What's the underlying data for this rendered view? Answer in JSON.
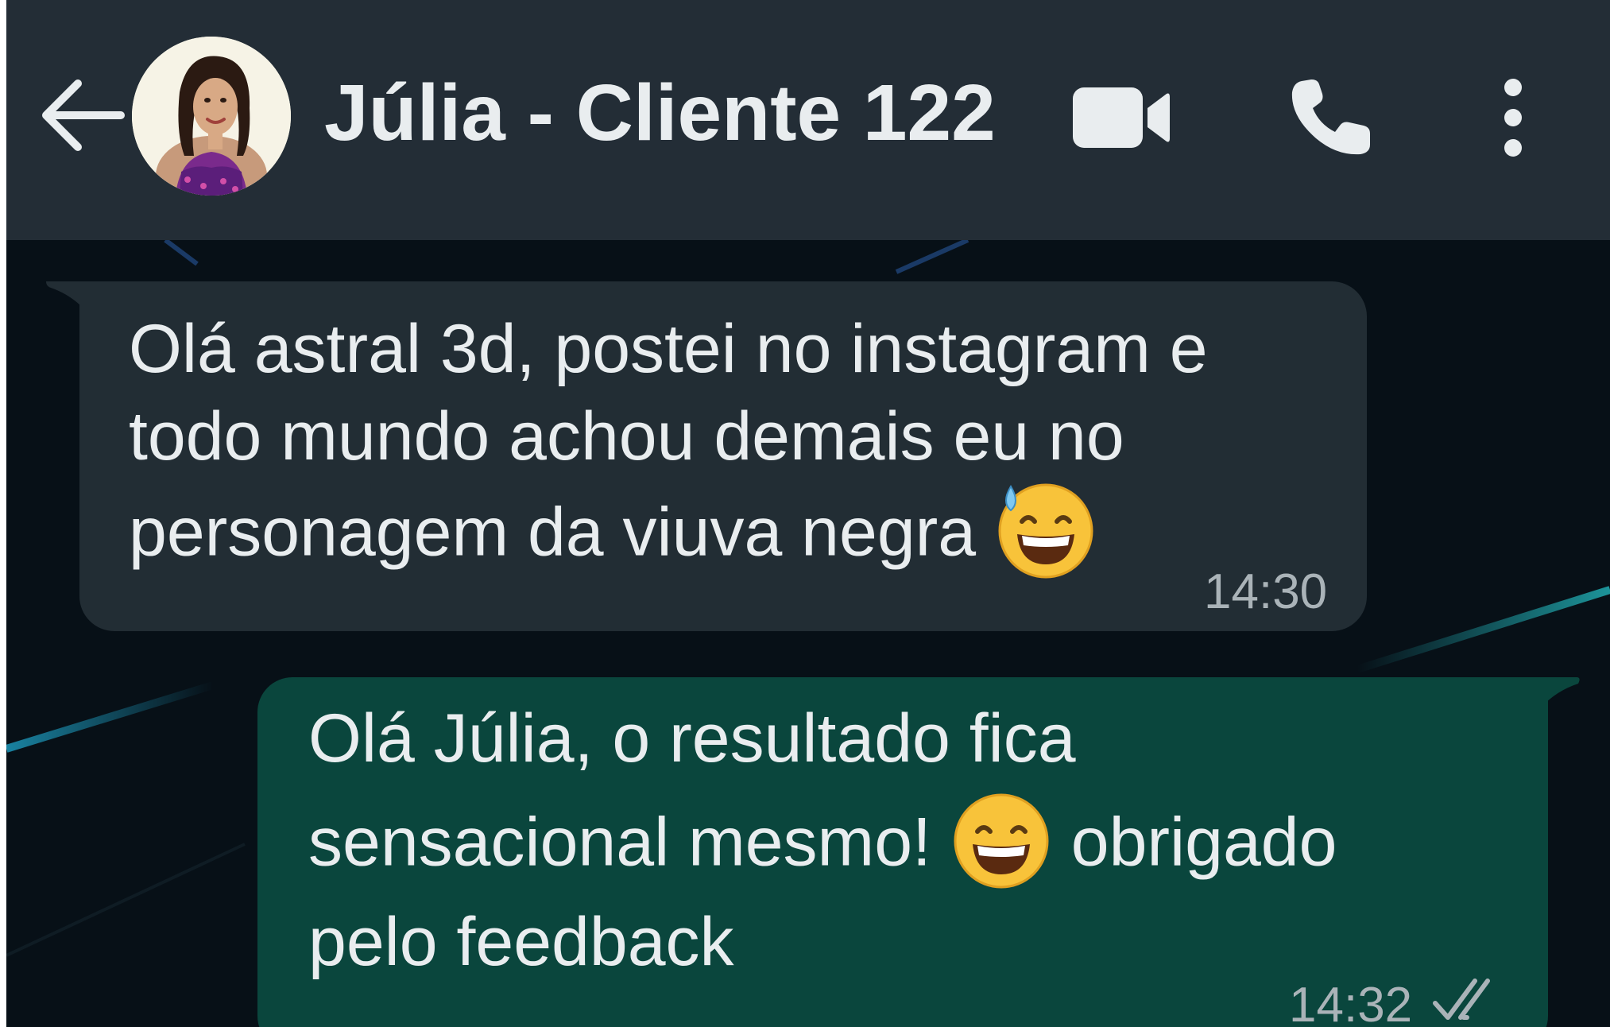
{
  "header": {
    "contact_name": "Júlia - Cliente 122",
    "icons": {
      "back": "back-arrow-icon",
      "video": "video-call-icon",
      "call": "phone-call-icon",
      "menu": "more-options-icon"
    }
  },
  "messages": [
    {
      "direction": "incoming",
      "lines": [
        "Olá astral 3d, postei no instagram e",
        "todo mundo achou demais eu no",
        "personagem da viuva negra"
      ],
      "emoji": "grinning-face-with-sweat",
      "time": "14:30"
    },
    {
      "direction": "outgoing",
      "line1": "Olá Júlia, o resultado fica",
      "line2_before_emoji": "sensacional mesmo!",
      "line2_after_emoji": "obrigado",
      "line3": "pelo feedback",
      "emoji": "grinning-squinting-face",
      "time": "14:32",
      "status": "read-double-check"
    }
  ],
  "colors": {
    "header_bg": "#232d36",
    "chat_bg": "#0b141a",
    "incoming_bubble": "#222d34",
    "outgoing_bubble": "#0a463d",
    "text": "#e9edef",
    "time_text": "#aab3b8"
  }
}
